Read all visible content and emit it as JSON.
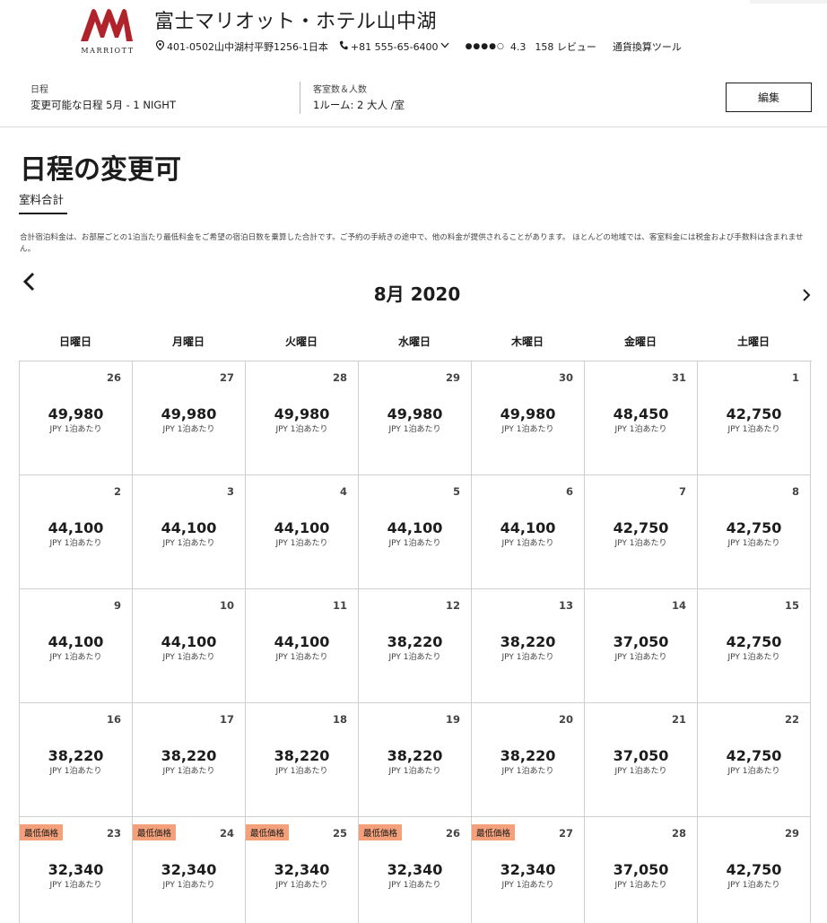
{
  "header": {
    "brand": "MARRIOTT",
    "hotel_name": "富士マリオット・ホテル山中湖",
    "address": "401-0502山中湖村平野1256-1日本",
    "phone": "+81 555-65-6400",
    "rating_dots": "●●●●○",
    "rating": "4.3",
    "reviews": "158 レビュー",
    "currency_tool": "通貨換算ツール"
  },
  "booking": {
    "dates_label": "日程",
    "dates_value": "変更可能な日程 5月 - 1 NIGHT",
    "rooms_label": "客室数＆人数",
    "rooms_value": "1ルーム: 2 大人 /室",
    "edit_label": "編集"
  },
  "page": {
    "title": "日程の変更可",
    "tab_label": "室料合計",
    "note": "合計宿泊料金は、お部屋ごとの1泊当たり最低料金をご希望の宿泊日数を乗算した合計です。ご予約の手続きの途中で、他の料金が提供されることがあります。 ほとんどの地域では、客室料金には税金および手数料は含まれません。"
  },
  "calendar": {
    "month": "8月 2020",
    "weekdays": [
      "日曜日",
      "月曜日",
      "火曜日",
      "水曜日",
      "木曜日",
      "金曜日",
      "土曜日"
    ],
    "unit": "JPY 1泊あたり",
    "lowest_label": "最低価格",
    "weeks": [
      [
        {
          "day": "26",
          "price": "49,980"
        },
        {
          "day": "27",
          "price": "49,980"
        },
        {
          "day": "28",
          "price": "49,980"
        },
        {
          "day": "29",
          "price": "49,980"
        },
        {
          "day": "30",
          "price": "49,980"
        },
        {
          "day": "31",
          "price": "48,450"
        },
        {
          "day": "1",
          "price": "42,750"
        }
      ],
      [
        {
          "day": "2",
          "price": "44,100"
        },
        {
          "day": "3",
          "price": "44,100"
        },
        {
          "day": "4",
          "price": "44,100"
        },
        {
          "day": "5",
          "price": "44,100"
        },
        {
          "day": "6",
          "price": "44,100"
        },
        {
          "day": "7",
          "price": "42,750"
        },
        {
          "day": "8",
          "price": "42,750"
        }
      ],
      [
        {
          "day": "9",
          "price": "44,100"
        },
        {
          "day": "10",
          "price": "44,100"
        },
        {
          "day": "11",
          "price": "44,100"
        },
        {
          "day": "12",
          "price": "38,220"
        },
        {
          "day": "13",
          "price": "38,220"
        },
        {
          "day": "14",
          "price": "37,050"
        },
        {
          "day": "15",
          "price": "42,750"
        }
      ],
      [
        {
          "day": "16",
          "price": "38,220"
        },
        {
          "day": "17",
          "price": "38,220"
        },
        {
          "day": "18",
          "price": "38,220"
        },
        {
          "day": "19",
          "price": "38,220"
        },
        {
          "day": "20",
          "price": "38,220"
        },
        {
          "day": "21",
          "price": "37,050"
        },
        {
          "day": "22",
          "price": "42,750"
        }
      ],
      [
        {
          "day": "23",
          "price": "32,340",
          "lowest": true
        },
        {
          "day": "24",
          "price": "32,340",
          "lowest": true
        },
        {
          "day": "25",
          "price": "32,340",
          "lowest": true
        },
        {
          "day": "26",
          "price": "32,340",
          "lowest": true
        },
        {
          "day": "27",
          "price": "32,340",
          "lowest": true
        },
        {
          "day": "28",
          "price": "37,050"
        },
        {
          "day": "29",
          "price": "42,750"
        }
      ]
    ]
  },
  "colors": {
    "brand": "#b0232a",
    "badge": "#f4a07a",
    "text": "#1c1c1c",
    "border": "#cfcfcf"
  }
}
